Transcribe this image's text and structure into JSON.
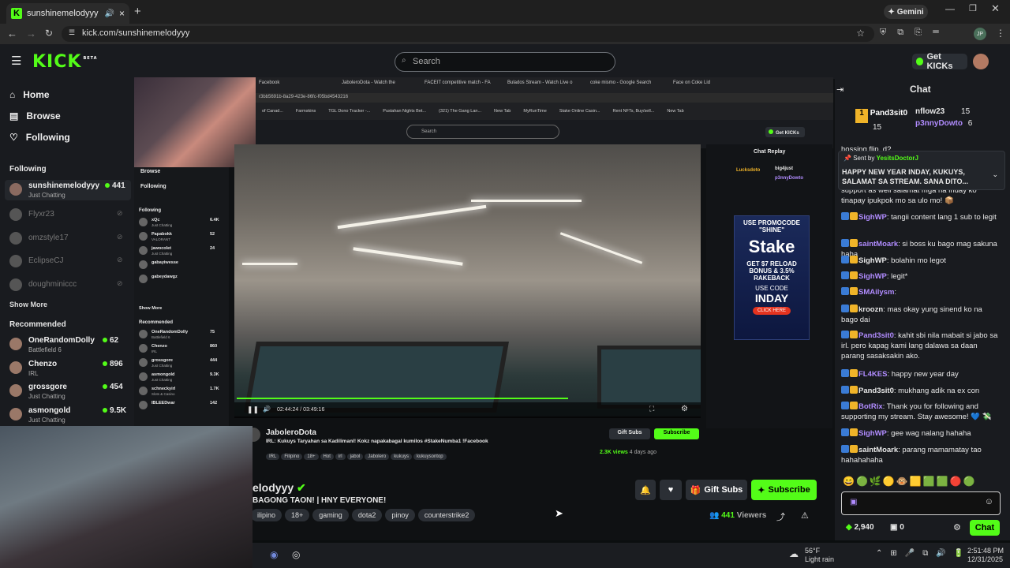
{
  "browser": {
    "tab_title": "sunshinemelodyyy Stream",
    "url": "kick.com/sunshinemelodyyy",
    "gemini_label": "Gemini",
    "profile_initials": "JP"
  },
  "header": {
    "logo": "KICK",
    "logo_beta": "BETA",
    "search_placeholder": "Search",
    "get_kicks": "Get KICKs"
  },
  "nav": {
    "home": "Home",
    "browse": "Browse",
    "following": "Following"
  },
  "following": {
    "title": "Following",
    "live": {
      "name": "sunshinemelodyyy",
      "category": "Just Chatting",
      "viewers": "441"
    },
    "offline": [
      "Flyxr23",
      "omzstyle17",
      "EclipseCJ",
      "doughminiccc"
    ],
    "show_more": "Show More"
  },
  "recommended": {
    "title": "Recommended",
    "items": [
      {
        "name": "OneRandomDolly",
        "category": "Battlefield 6",
        "viewers": "62"
      },
      {
        "name": "Chenzo",
        "category": "IRL",
        "viewers": "896"
      },
      {
        "name": "grossgore",
        "category": "Just Chatting",
        "viewers": "454"
      },
      {
        "name": "asmongold",
        "category": "Just Chatting",
        "viewers": "9.5K"
      }
    ]
  },
  "inner_window": {
    "tabs": [
      "Facebook",
      "JaboleroDota - Watch the",
      "FACEIT competitive match - FA",
      "Bulados Stream - Watch Live o",
      "coke mismo - Google Search",
      "Face on Coke Lid"
    ],
    "url": "r3bb5691b-8a29-423e-86fc-f05bd4543216",
    "bookmarks": [
      "of Canad...",
      "Farmskins",
      "TGL Dono Tracker -...",
      "Pustahan Nights Bet...",
      "(321) The Gang Lan...",
      "New Tab",
      "MyRunTime",
      "Stake Online Casin...",
      "Rent NFTs, Buy/sell...",
      "New Tab"
    ],
    "search_placeholder": "Search",
    "get_kicks": "Get KICKs",
    "sidebar_browse": "Browse",
    "sidebar_following": "Following",
    "following_title": "Following",
    "following_items": [
      {
        "name": "xQc",
        "category": "Just Chatting",
        "viewers": "6.4K"
      },
      {
        "name": "Papabokk",
        "category": "VALORANT",
        "viewers": "52"
      },
      {
        "name": "jawocolet",
        "category": "Just Chatting",
        "viewers": "24"
      },
      {
        "name": "gabayiwesse",
        "category": "",
        "viewers": ""
      },
      {
        "name": "gabeydawgz",
        "category": "",
        "viewers": ""
      }
    ],
    "show_more": "Show More",
    "recommended_title": "Recommended",
    "recommended_items": [
      {
        "name": "OneRandomDolly",
        "category": "Battlefield 6",
        "viewers": "75"
      },
      {
        "name": "Chenzo",
        "category": "IRL",
        "viewers": "860"
      },
      {
        "name": "grossgore",
        "category": "Just Chatting",
        "viewers": "444"
      },
      {
        "name": "asmongold",
        "category": "Just Chatting",
        "viewers": "9.3K"
      },
      {
        "name": "schneckyirl",
        "category": "Slots & Casino",
        "viewers": "1.7K"
      },
      {
        "name": "IBLEEDwar",
        "category": "",
        "viewers": "142"
      }
    ],
    "player_time": "02:44:24 / 03:49:16",
    "chat_replay": "Chat Replay",
    "chat_top": [
      "Lucksdoto",
      "big4just",
      "p3nnyDowto"
    ],
    "ad": {
      "promo": "USE PROMOCODE",
      "code_word": "\"SHINE\"",
      "brand": "Stake",
      "offer": "GET $7 RELOAD BONUS & 3.5% RAKEBACK",
      "use_code": "USE CODE",
      "code": "INDAY",
      "cta": "CLICK HERE"
    },
    "streamer": "JaboleroDota",
    "stream_title": "IRL: Kukuys Taryahan sa Kadilimanl! Kokz napakabagal kumilos #StakeNumba1 !Facebook",
    "tags": [
      "IRL",
      "Filipino",
      "18+",
      "Hot",
      "irl",
      "jabol",
      "Jabolero",
      "kukuys",
      "kukuysontop"
    ],
    "views": "2.3K views",
    "ago": "4 days ago",
    "gift_subs": "Gift Subs",
    "subscribe": "Subscribe"
  },
  "stream": {
    "name": "elodyyy",
    "title": "BAGONG TAON! | HNY EVERYONE!",
    "tags": [
      "ilipino",
      "18+",
      "gaming",
      "dota2",
      "pinoy",
      "counterstrike2"
    ],
    "viewers": "441",
    "viewers_label": "Viewers",
    "gift_subs": "Gift Subs",
    "subscribe": "Subscribe"
  },
  "chat": {
    "title": "Chat",
    "top_gifters": [
      {
        "rank": "1",
        "name": "Pand3sit0",
        "count": "15"
      },
      {
        "name": "nflow23",
        "count": "15"
      },
      {
        "name": "p3nnyDowto",
        "count": "6"
      }
    ],
    "pinned": {
      "sent_by_label": "Sent by",
      "sender": "YesitsDoctorJ",
      "text": "HAPPY NEW YEAR INDAY, KUKUYS, SALAMAT SA STREAM. SANA DITO..."
    },
    "messages": [
      {
        "user": "",
        "text": "hossing flip_d?"
      },
      {
        "user": "",
        "text": "support as well salamat mga na  inday ko tinapay ipukpok mo sa ulo mo! 📦"
      },
      {
        "user": "SighWP",
        "text": ": tangii content lang 1 sub to legit"
      },
      {
        "user": "saintMoark",
        "text": ": si boss ku bago mag sakuna haha"
      },
      {
        "user": "SighWP",
        "text": ": bolahin mo legot"
      },
      {
        "user": "SighWP",
        "text": ": legit*"
      },
      {
        "user": "SMAilysm",
        "text": ":"
      },
      {
        "user": "kroozn",
        "text": ": mas okay yung sinend ko na bago dai"
      },
      {
        "user": "Pand3sit0",
        "text": ": kahit sbi nila mabait si jabo sa irl. pero kapag kami lang dalawa sa daan parang sasaksakin ako."
      },
      {
        "user": "FL4KES",
        "text": ": happy new year day"
      },
      {
        "user": "Pand3sit0",
        "text": ": mukhang adik na ex con"
      },
      {
        "user": "BotRix",
        "text": ": Thank you for following and supporting my stream. Stay awesome! 💙 💸"
      },
      {
        "user": "SighWP",
        "text": ": gee wag nalang hahaha"
      },
      {
        "user": "saintMoark",
        "text": ": parang mamamatay tao hahahahaha"
      }
    ],
    "kicks_count": "2,940",
    "drops_count": "0",
    "send_label": "Chat"
  },
  "taskbar": {
    "weather_temp": "56°F",
    "weather_desc": "Light rain",
    "time": "2:51:48 PM",
    "date": "12/31/2025"
  },
  "colors": {
    "brand": "#53fc18",
    "bg": "#0b0e0f",
    "panel": "#191b1f",
    "username": "#b18cff"
  }
}
